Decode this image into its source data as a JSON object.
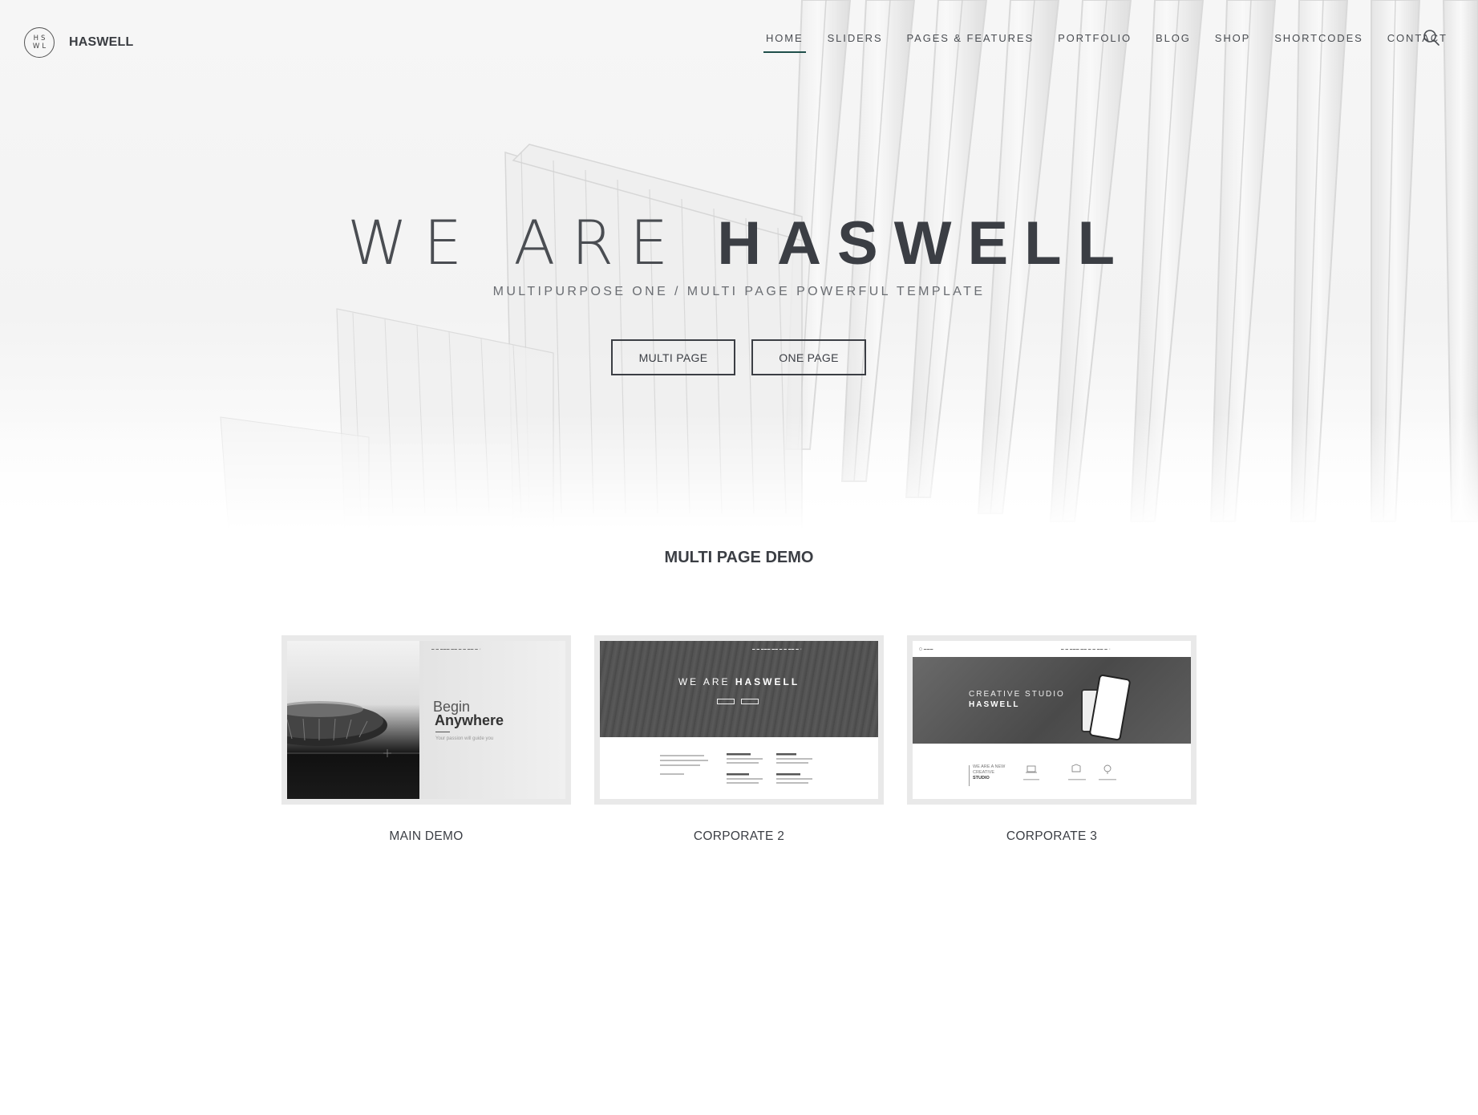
{
  "brand": {
    "logo_mark": "HSWL",
    "name": "HASWELL"
  },
  "nav": {
    "items": [
      {
        "label": "HOME",
        "active": true
      },
      {
        "label": "SLIDERS",
        "active": false
      },
      {
        "label": "PAGES & FEATURES",
        "active": false
      },
      {
        "label": "PORTFOLIO",
        "active": false
      },
      {
        "label": "BLOG",
        "active": false
      },
      {
        "label": "SHOP",
        "active": false
      },
      {
        "label": "SHORTCODES",
        "active": false
      },
      {
        "label": "CONTACT",
        "active": false
      }
    ],
    "search_icon": "search-icon"
  },
  "hero": {
    "title_light": "WE ARE",
    "title_bold": "HASWELL",
    "subtitle": "MULTIPURPOSE ONE / MULTI PAGE POWERFUL TEMPLATE",
    "buttons": {
      "multi_page": "MULTI PAGE",
      "one_page": "ONE PAGE"
    }
  },
  "demos": {
    "section_title": "MULTI PAGE DEMO",
    "cards": [
      {
        "label": "MAIN DEMO",
        "thumb": {
          "line1": "Begin",
          "line2": "Anywhere",
          "small": "Your passion will guide you"
        }
      },
      {
        "label": "CORPORATE 2",
        "thumb": {
          "title_light": "WE ARE",
          "title_bold": "HASWELL"
        }
      },
      {
        "label": "CORPORATE 3",
        "thumb": {
          "title1": "CREATIVE STUDIO",
          "title2": "HASWELL",
          "tagline1": "WE ARE A NEW",
          "tagline2": "CREATIVE",
          "tagline3": "STUDIO"
        }
      }
    ]
  },
  "colors": {
    "text_dark": "#3b3e44",
    "nav_active_underline": "#1f4f4a",
    "card_frame": "#e9e9e9"
  }
}
